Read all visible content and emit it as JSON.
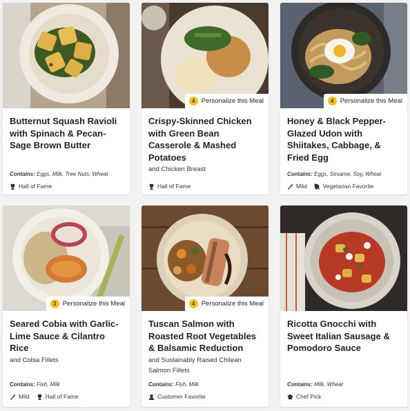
{
  "pill_label": "Personalize this Meal",
  "contains_prefix": "Contains:",
  "colors": {
    "badge": "#f2c129",
    "card": "#ffffff",
    "page": "#f2f2f2"
  },
  "meals": [
    {
      "title": "Butternut Squash Ravioli with Spinach & Pecan-Sage Brown Butter",
      "subtitle": "",
      "contains": "Eggs, Milk, Tree Nuts, Wheat",
      "pill_count": null,
      "tags": [
        {
          "icon": "trophy-icon",
          "label": "Hall of Fame"
        }
      ]
    },
    {
      "title": "Crispy-Skinned Chicken with Green Bean Casserole & Mashed Potatoes",
      "subtitle": "and Chicken Breast",
      "contains": "",
      "pill_count": "4",
      "tags": [
        {
          "icon": "trophy-icon",
          "label": "Hall of Fame"
        }
      ]
    },
    {
      "title": "Honey & Black Pepper-Glazed Udon with Shiitakes, Cabbage, & Fried Egg",
      "subtitle": "",
      "contains": "Eggs, Sesame, Soy, Wheat",
      "pill_count": "4",
      "tags": [
        {
          "icon": "chili-pepper-icon",
          "label": "Mild"
        },
        {
          "icon": "vegetarian-leaf-icon",
          "label": "Vegetarian Favorite"
        }
      ]
    },
    {
      "title": "Seared Cobia with Garlic-Lime Sauce & Cilantro Rice",
      "subtitle": "and Cobia Fillets",
      "contains": "Fish, Milk",
      "pill_count": "3",
      "tags": [
        {
          "icon": "chili-pepper-icon",
          "label": "Mild"
        },
        {
          "icon": "trophy-icon",
          "label": "Hall of Fame"
        }
      ]
    },
    {
      "title": "Tuscan Salmon with Roasted Root Vegetables & Balsamic Reduction",
      "subtitle": "and Sustainably Raised Chilean Salmon Fillets",
      "contains": "Fish, Milk",
      "pill_count": "4",
      "tags": [
        {
          "icon": "customer-favorite-icon",
          "label": "Customer Favorite"
        }
      ]
    },
    {
      "title": "Ricotta Gnocchi with Sweet Italian Sausage & Pomodoro Sauce",
      "subtitle": "",
      "contains": "Milk, Wheat",
      "pill_count": null,
      "tags": [
        {
          "icon": "chef-hat-icon",
          "label": "Chef Pick"
        }
      ]
    }
  ]
}
